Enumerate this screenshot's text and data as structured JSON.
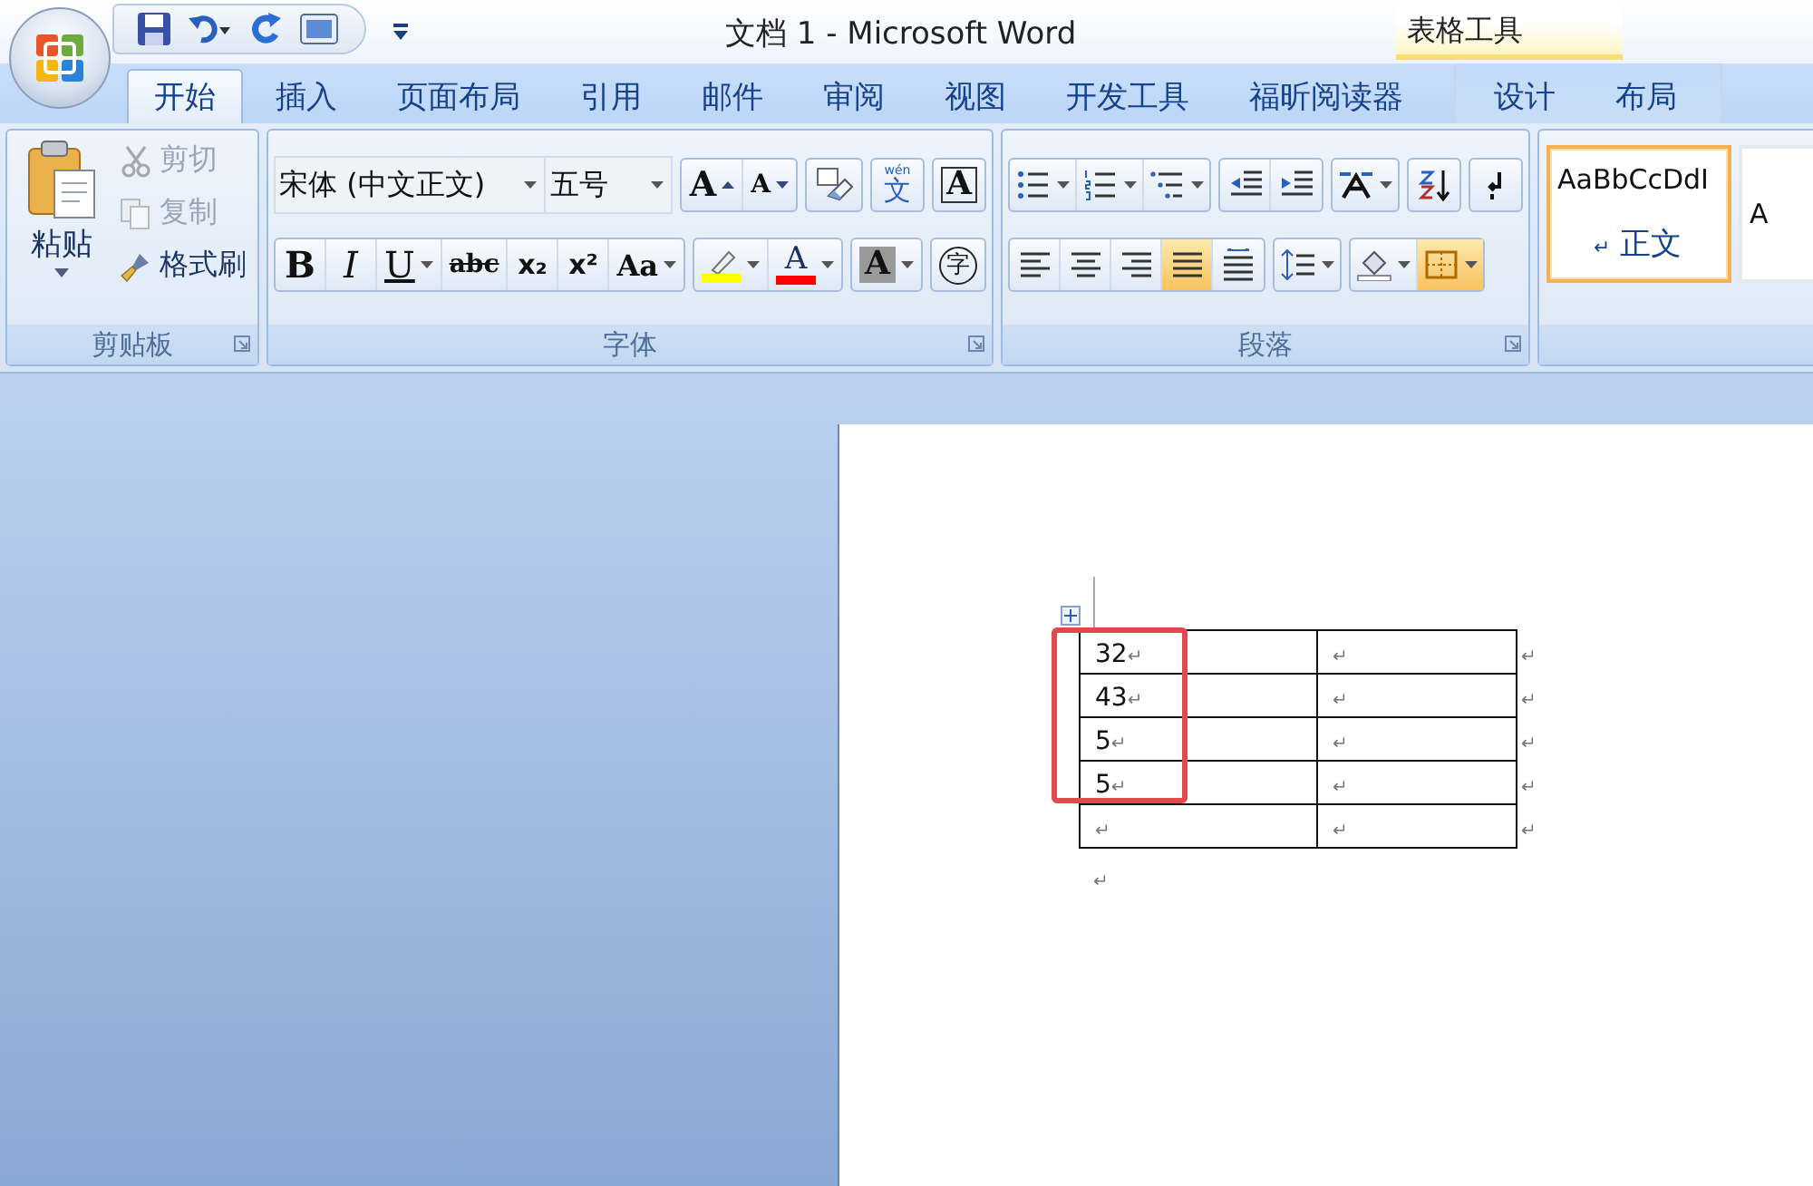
{
  "window": {
    "title": "文档 1 - Microsoft Word"
  },
  "tabs": [
    {
      "label": "开始",
      "selected": true
    },
    {
      "label": "插入",
      "selected": false
    },
    {
      "label": "页面布局",
      "selected": false
    },
    {
      "label": "引用",
      "selected": false
    },
    {
      "label": "邮件",
      "selected": false
    },
    {
      "label": "审阅",
      "selected": false
    },
    {
      "label": "视图",
      "selected": false
    },
    {
      "label": "开发工具",
      "selected": false
    },
    {
      "label": "福昕阅读器",
      "selected": false
    }
  ],
  "contextual_tabs": {
    "label": "表格工具",
    "tabs": [
      {
        "label": "设计",
        "selected": false
      },
      {
        "label": "布局",
        "selected": false
      }
    ]
  },
  "clipboard": {
    "label": "剪贴板",
    "paste": "粘贴",
    "actions": [
      {
        "kind": "cut",
        "label": "剪切",
        "disabled": true
      },
      {
        "kind": "copy",
        "label": "复制",
        "disabled": true
      },
      {
        "kind": "format-painter",
        "label": "格式刷",
        "disabled": false
      }
    ]
  },
  "font": {
    "label": "字体",
    "font_name": "宋体 (中文正文)",
    "font_size": "五号",
    "row_1": [
      [
        {
          "kind": "grow",
          "glyph": "A"
        },
        {
          "kind": "shrink",
          "glyph": "A"
        }
      ],
      [
        {
          "kind": "clear"
        }
      ],
      [
        {
          "kind": "phonetic",
          "glyph": "文",
          "ruby": "wén"
        }
      ],
      [
        {
          "kind": "border",
          "glyph": "A"
        }
      ]
    ],
    "row_2": [
      [
        {
          "kind": "bold",
          "glyph": "B"
        },
        {
          "kind": "italic",
          "glyph": "I"
        },
        {
          "kind": "underline",
          "glyph": "U"
        },
        {
          "kind": "strike",
          "glyph": "abc"
        },
        {
          "kind": "subscript",
          "glyph": "x₂"
        },
        {
          "kind": "superscript",
          "glyph": "x²"
        },
        {
          "kind": "case",
          "glyph": "Aa"
        }
      ],
      [
        {
          "kind": "highlight",
          "color": "#ffff00"
        },
        {
          "kind": "font-color",
          "glyph": "A",
          "color": "#ff0000"
        }
      ],
      [
        {
          "kind": "shading",
          "glyph": "A"
        }
      ],
      [
        {
          "kind": "enclose",
          "glyph": "字"
        }
      ]
    ]
  },
  "paragraph": {
    "label": "段落",
    "row_1": [
      [
        {
          "kind": "bullets",
          "selected": false
        },
        {
          "kind": "numbering",
          "selected": false
        },
        {
          "kind": "multilevel",
          "selected": false
        }
      ],
      [
        {
          "kind": "outdent",
          "selected": false
        },
        {
          "kind": "indent",
          "selected": false
        }
      ],
      [
        {
          "kind": "asian-layout",
          "selected": false
        }
      ],
      [
        {
          "kind": "sort",
          "selected": false
        }
      ],
      [
        {
          "kind": "show-marks",
          "selected": false
        }
      ]
    ],
    "row_2": [
      [
        {
          "kind": "align-left",
          "selected": false
        },
        {
          "kind": "center",
          "selected": false
        },
        {
          "kind": "align-right",
          "selected": false
        },
        {
          "kind": "justify",
          "selected": true
        },
        {
          "kind": "distributed",
          "selected": false
        }
      ],
      [
        {
          "kind": "line-spacing",
          "selected": false
        }
      ],
      [
        {
          "kind": "shading",
          "selected": false
        },
        {
          "kind": "borders",
          "selected": true
        }
      ]
    ]
  },
  "styles": [
    {
      "sample": "AaBbCcDdI",
      "mark": "↵",
      "name": "正文",
      "selected": true
    },
    {
      "sample": "A",
      "selected": false
    }
  ],
  "document": {
    "table": {
      "rows": [
        {
          "cells": [
            {
              "text": "32",
              "mark": "↵"
            },
            {
              "mark": "↵"
            }
          ],
          "end_mark": "↵"
        },
        {
          "cells": [
            {
              "text": "43",
              "mark": "↵"
            },
            {
              "mark": "↵"
            }
          ],
          "end_mark": "↵"
        },
        {
          "cells": [
            {
              "text": "5",
              "mark": "↵"
            },
            {
              "mark": "↵"
            }
          ],
          "end_mark": "↵"
        },
        {
          "cells": [
            {
              "text": "5",
              "mark": "↵"
            },
            {
              "mark": "↵"
            }
          ],
          "end_mark": "↵"
        },
        {
          "cells": [
            {
              "mark": "↵"
            },
            {
              "mark": "↵"
            }
          ],
          "end_mark": "↵"
        }
      ]
    },
    "after_table": "↵"
  }
}
